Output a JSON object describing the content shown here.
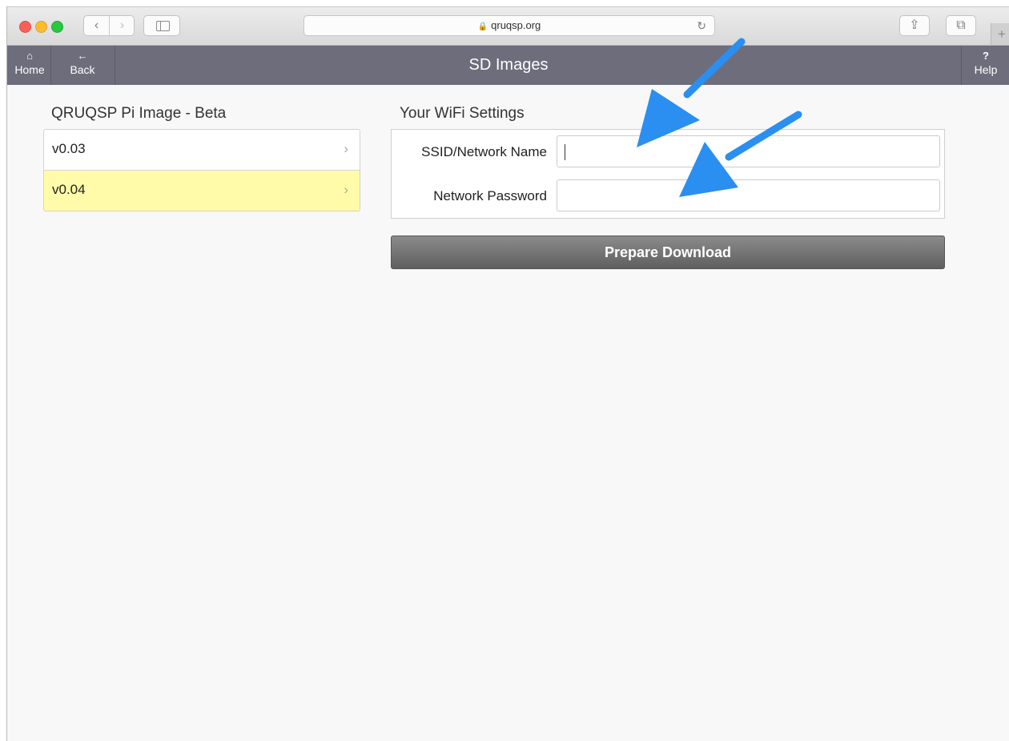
{
  "browser": {
    "back_glyph": "‹",
    "forward_glyph": "›",
    "lock_glyph": "🔒",
    "url": "qruqsp.org",
    "reload_glyph": "↻",
    "share_glyph": "⇪",
    "tabs_glyph": "⧉",
    "newtab_glyph": "+"
  },
  "header": {
    "title": "SD Images",
    "home": {
      "icon": "home-icon",
      "glyph": "⌂",
      "label": "Home"
    },
    "back": {
      "icon": "back-arrow-icon",
      "glyph": "←",
      "label": "Back"
    },
    "help": {
      "icon": "help-icon",
      "glyph": "?",
      "label": "Help"
    }
  },
  "images": {
    "title": "QRUQSP Pi Image - Beta",
    "items": [
      {
        "label": "v0.03",
        "selected": false
      },
      {
        "label": "v0.04",
        "selected": true
      }
    ],
    "chevron": "›"
  },
  "wifi": {
    "title": "Your WiFi Settings",
    "ssid_label": "SSID/Network Name",
    "ssid_value": "",
    "password_label": "Network Password",
    "password_value": ""
  },
  "actions": {
    "prepare_download": "Prepare Download"
  },
  "annotation": {
    "arrow_color": "#2a8ff0"
  }
}
